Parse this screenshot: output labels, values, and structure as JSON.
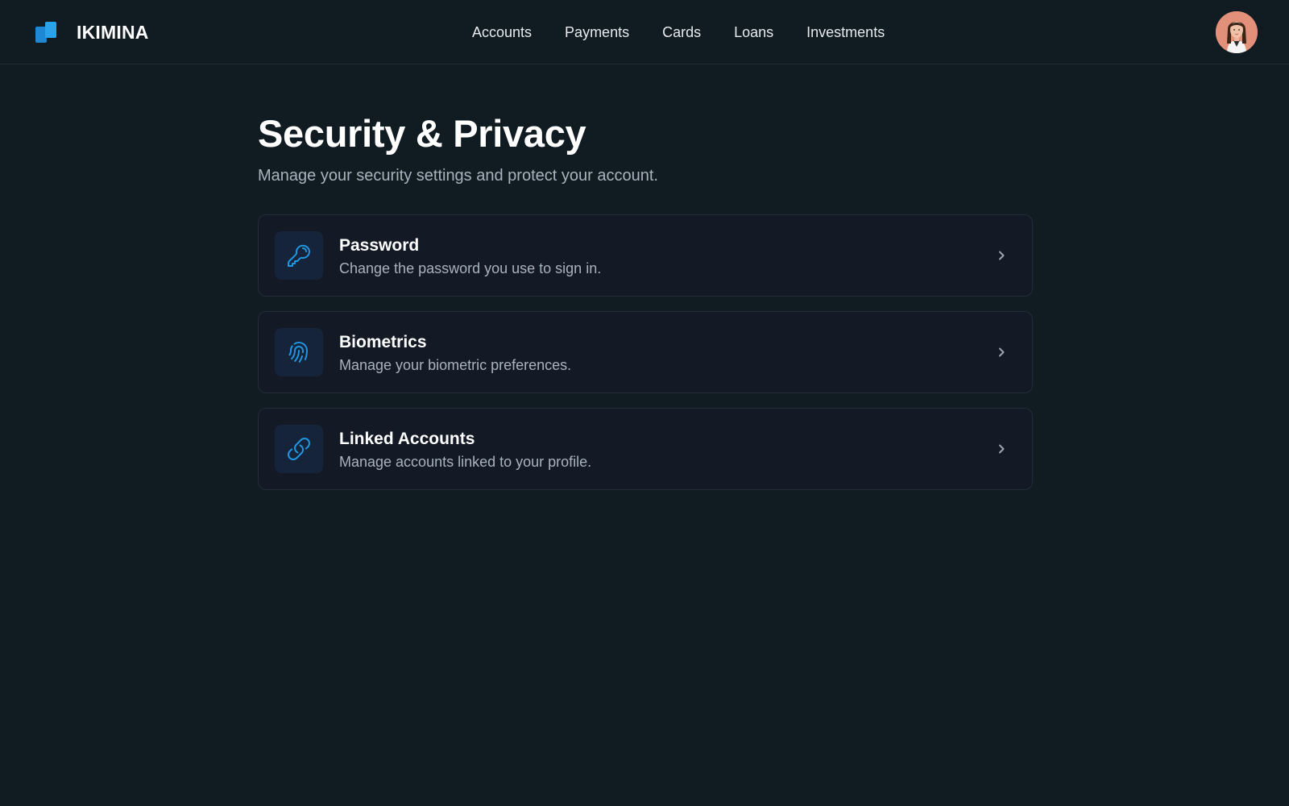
{
  "header": {
    "brand": "IKIMINA",
    "nav": [
      "Accounts",
      "Payments",
      "Cards",
      "Loans",
      "Investments"
    ]
  },
  "page": {
    "title": "Security & Privacy",
    "subtitle": "Manage your security settings and protect your account."
  },
  "settings": [
    {
      "title": "Password",
      "description": "Change the password you use to sign in.",
      "icon": "key-icon"
    },
    {
      "title": "Biometrics",
      "description": "Manage your biometric preferences.",
      "icon": "fingerprint-icon"
    },
    {
      "title": "Linked Accounts",
      "description": "Manage accounts linked to your profile.",
      "icon": "link-icon"
    }
  ],
  "colors": {
    "background": "#111b22",
    "accent": "#2196e0",
    "card": "#131a26",
    "muted_text": "#a9b3bd"
  }
}
